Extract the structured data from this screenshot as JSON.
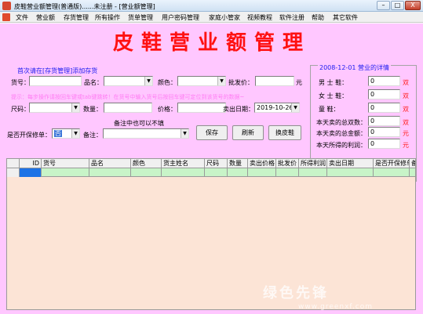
{
  "window": {
    "title": "皮鞋营业额管理(普通版)......未注册 - [营业额管理]",
    "min": "–",
    "max": "□",
    "close": "X"
  },
  "menu": [
    "文件",
    "营业额",
    "存货管理",
    "所有操作",
    "货单管理",
    "用户密码管理",
    "家庭小管家",
    "视频教程",
    "软件注册",
    "帮助",
    "其它软件"
  ],
  "header": {
    "title": "皮鞋营业额管理"
  },
  "hints": {
    "stock": "首次请在[存货管理]添加存货",
    "tip": "提示：每步操作请按回车键或tab键跳转！在货号中输入货号后按回车键可定位到该货号的数据~",
    "remark_tip": "备注中也可以不填"
  },
  "form": {
    "huohao_label": "货号：",
    "huohao_value": "",
    "pinming_label": "品名：",
    "pinming_value": "",
    "yanse_label": "颜色：",
    "yanse_value": "",
    "pifajia_label": "批发价：",
    "pifajia_value": "",
    "pifajia_unit": "元",
    "chima_label": "尺码：",
    "chima_value": "",
    "shuliang_label": "数量：",
    "shuliang_value": "",
    "jiage_label": "价格：",
    "jiage_value": "",
    "date_label": "卖出日期：",
    "date_value": "2019-10-26",
    "baoxiu_label": "是否开保修单：",
    "baoxiu_value": "否",
    "beizhu_label": "备注：",
    "beizhu_value": ""
  },
  "buttons": {
    "save": "保存",
    "refresh": "刷新",
    "change": "换皮鞋"
  },
  "stats": {
    "title": "2008-12-01 营业的详情",
    "rows": [
      {
        "label": "男 士 鞋：",
        "value": "0",
        "unit": "双"
      },
      {
        "label": "女 士 鞋：",
        "value": "0",
        "unit": "双"
      },
      {
        "label": "童    鞋：",
        "value": "0",
        "unit": "双"
      },
      {
        "label": "本天卖的总双数：",
        "value": "0",
        "unit": "双"
      },
      {
        "label": "本天卖的总金额：",
        "value": "0",
        "unit": "元"
      },
      {
        "label": "本天所得的利润：",
        "value": "0",
        "unit": "元"
      }
    ]
  },
  "grid": {
    "columns": [
      "ID",
      "货号",
      "品名",
      "颜色",
      "货主姓名",
      "尺码",
      "数量",
      "卖出价格",
      "批发价",
      "所得利润",
      "卖出日期",
      "是否开保修单",
      "备"
    ]
  },
  "watermark": {
    "text": "绿色先锋",
    "url": "www.greenxf.com"
  },
  "colors": {
    "title": "#ff1111",
    "hint": "#1d1df0",
    "tip": "#ff7cf3",
    "background": "#ffc7ff",
    "grid": "#fce4d6",
    "selected_row": "#c8f4c8"
  }
}
